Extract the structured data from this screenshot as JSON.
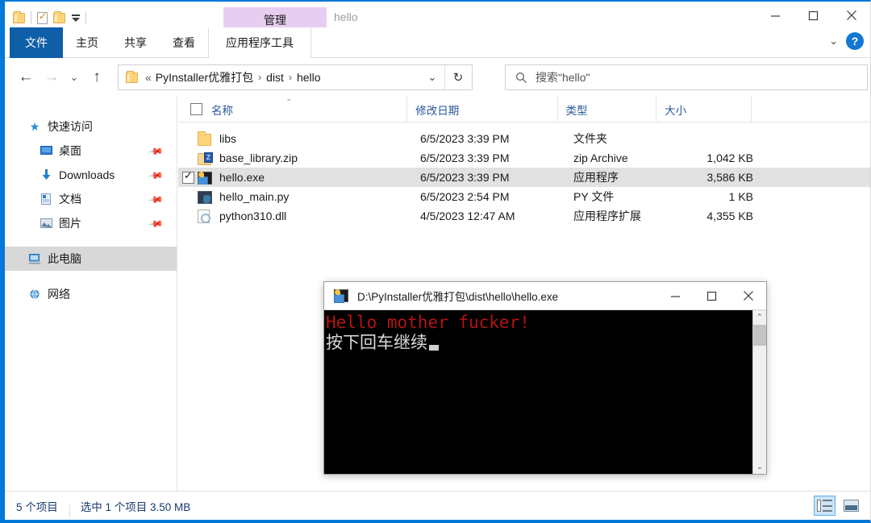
{
  "window": {
    "title": "hello",
    "contextual_tab": "管理",
    "minimize": "—",
    "maximize": "□",
    "close": "✕",
    "ribbon_collapse": "⌄",
    "help": "?"
  },
  "quick_access_toolbar": {
    "items": [
      {
        "name": "folder-icon",
        "label": "属性"
      },
      {
        "name": "properties-icon",
        "label": "属性"
      },
      {
        "name": "new-folder-icon",
        "label": "新建文件夹"
      },
      {
        "name": "customize-caret-icon",
        "label": "自定义快速访问工具栏"
      }
    ]
  },
  "ribbon": {
    "tabs": [
      {
        "label": "文件",
        "active_style": "file"
      },
      {
        "label": "主页",
        "active_style": "normal"
      },
      {
        "label": "共享",
        "active_style": "normal"
      },
      {
        "label": "查看",
        "active_style": "normal"
      },
      {
        "label": "应用程序工具",
        "active_style": "contextual"
      }
    ]
  },
  "navigation": {
    "back": "←",
    "forward": "→",
    "recent": "⌄",
    "up": "↑",
    "address": {
      "leading": "«",
      "crumbs": [
        "PyInstaller优雅打包",
        "dist",
        "hello"
      ],
      "separator": "›",
      "dropdown": "⌄",
      "refresh": "↻"
    },
    "search": {
      "placeholder": "搜索\"hello\"",
      "icon": "search-icon"
    }
  },
  "sidebar": {
    "items": [
      {
        "label": "快速访问",
        "icon": "star-icon",
        "level": 1,
        "pinned": false,
        "selected": false
      },
      {
        "label": "桌面",
        "icon": "desktop-icon",
        "level": 2,
        "pinned": true,
        "selected": false
      },
      {
        "label": "Downloads",
        "icon": "download-icon",
        "level": 2,
        "pinned": true,
        "selected": false
      },
      {
        "label": "文档",
        "icon": "documents-icon",
        "level": 2,
        "pinned": true,
        "selected": false
      },
      {
        "label": "图片",
        "icon": "pictures-icon",
        "level": 2,
        "pinned": true,
        "selected": false
      },
      {
        "label": "此电脑",
        "icon": "this-pc-icon",
        "level": 1,
        "pinned": false,
        "selected": true
      },
      {
        "label": "网络",
        "icon": "network-icon",
        "level": 1,
        "pinned": false,
        "selected": false
      }
    ]
  },
  "file_list": {
    "columns": [
      {
        "key": "name",
        "label": "名称",
        "sorted": "asc"
      },
      {
        "key": "date",
        "label": "修改日期",
        "sorted": null
      },
      {
        "key": "type",
        "label": "类型",
        "sorted": null
      },
      {
        "key": "size",
        "label": "大小",
        "sorted": null
      }
    ],
    "sort_indicator": "⌃",
    "rows": [
      {
        "name": "libs",
        "date": "6/5/2023 3:39 PM",
        "type": "文件夹",
        "size": "",
        "icon": "folder-icon",
        "selected": false,
        "checked": false
      },
      {
        "name": "base_library.zip",
        "date": "6/5/2023 3:39 PM",
        "type": "zip Archive",
        "size": "1,042 KB",
        "icon": "zip-icon",
        "selected": false,
        "checked": false
      },
      {
        "name": "hello.exe",
        "date": "6/5/2023 3:39 PM",
        "type": "应用程序",
        "size": "3,586 KB",
        "icon": "exe-icon",
        "selected": true,
        "checked": true
      },
      {
        "name": "hello_main.py",
        "date": "6/5/2023 2:54 PM",
        "type": "PY 文件",
        "size": "1 KB",
        "icon": "python-icon",
        "selected": false,
        "checked": false
      },
      {
        "name": "python310.dll",
        "date": "4/5/2023 12:47 AM",
        "type": "应用程序扩展",
        "size": "4,355 KB",
        "icon": "dll-icon",
        "selected": false,
        "checked": false
      }
    ]
  },
  "status_bar": {
    "item_count": "5 个项目",
    "selection": "选中 1 个项目  3.50 MB",
    "view_details": "详细信息",
    "view_large_icons": "大图标"
  },
  "console_window": {
    "title": "D:\\PyInstaller优雅打包\\dist\\hello\\hello.exe",
    "icon": "exe-icon",
    "minimize": "—",
    "maximize": "□",
    "close": "✕",
    "lines": [
      {
        "text": "Hello mother fucker!",
        "color": "#b31313"
      },
      {
        "text": "按下回车继续",
        "color": "#d8d8d8"
      }
    ],
    "scrollbar": {
      "up": "⌃",
      "down": "⌄"
    }
  },
  "colors": {
    "accent": "#0078d7",
    "file_tab": "#0f5ea8",
    "contextual_tab": "#e7cdf0",
    "selection": "#e1e1e1",
    "console_text_red": "#b31313",
    "console_bg": "#000000",
    "column_header_text": "#2a5699"
  }
}
